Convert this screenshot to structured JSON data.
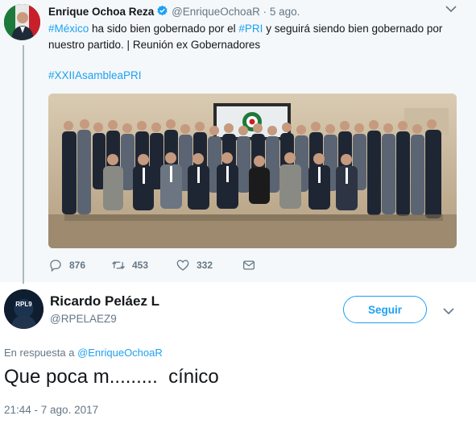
{
  "parent_tweet": {
    "author_name": "Enrique Ochoa Reza",
    "author_handle": "@EnriqueOchoaR",
    "separator": "·",
    "time": "5 ago.",
    "text_tag1": "#México",
    "text_part1": " ha sido bien gobernado por el ",
    "text_tag2": "#PRI",
    "text_part2": " y seguirá siendo bien gobernado por nuestro partido. | Reunión ex Gobernadores",
    "hashtag": "#XXIIAsambleaPRI",
    "photo_icon": "group-photo",
    "reply_count": "876",
    "retweet_count": "453",
    "like_count": "332",
    "icons": [
      "verified-badge",
      "reply-icon",
      "retweet-icon",
      "like-icon",
      "message-icon",
      "chevron-down-icon"
    ]
  },
  "reply_tweet": {
    "avatar_text": "RPL9",
    "author_name": "Ricardo Peláez L",
    "author_handle": "@RPELAEZ9",
    "follow_label": "Seguir",
    "reply_prefix": "En respuesta a ",
    "reply_to_handle": "@EnriqueOchoaR",
    "text": "Que poca m.........  cínico",
    "timestamp": "21:44 - 7 ago. 2017"
  },
  "colors": {
    "accent": "#1da1f2",
    "muted": "#657786",
    "text": "#14171a",
    "parent_background": "#f5f8fa"
  }
}
